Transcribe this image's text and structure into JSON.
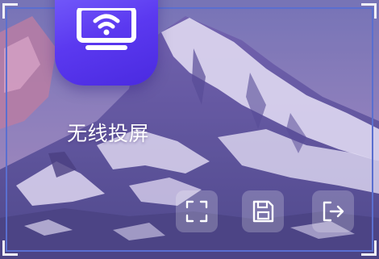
{
  "app": {
    "label": "无线投屏",
    "icon": "wireless-screen-cast-icon",
    "tile_color": "#5b39f0"
  },
  "controls": [
    {
      "icon": "fullscreen-icon"
    },
    {
      "icon": "save-icon"
    },
    {
      "icon": "exit-icon"
    }
  ],
  "colors": {
    "frame_border": "#5a6fd0",
    "label_text": "#ffffff"
  }
}
